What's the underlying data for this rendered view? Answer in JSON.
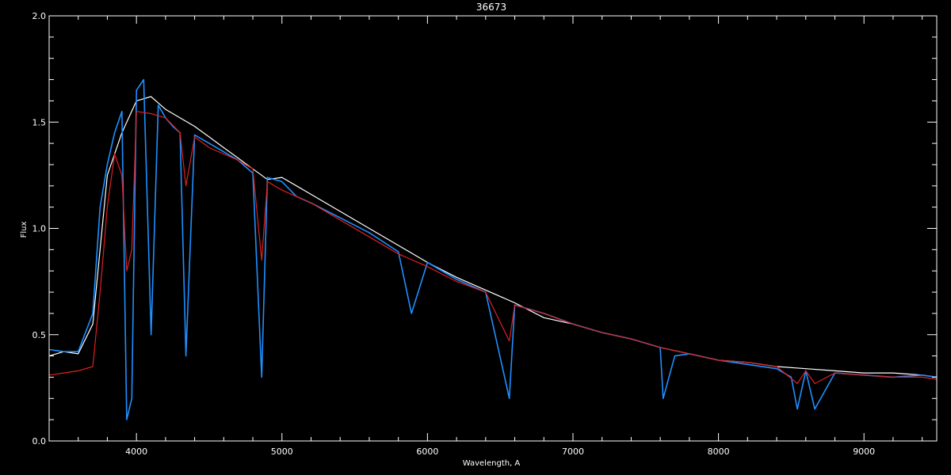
{
  "chart_data": {
    "type": "line",
    "title": "36673",
    "xlabel": "Wavelength, A",
    "ylabel": "Flux",
    "xlim": [
      3400,
      9500
    ],
    "ylim": [
      0.0,
      2.0
    ],
    "x_ticks": [
      4000,
      5000,
      6000,
      7000,
      8000,
      9000
    ],
    "x_tick_labels": [
      "4000",
      "5000",
      "6000",
      "7000",
      "8000",
      "9000"
    ],
    "y_ticks": [
      0.0,
      0.5,
      1.0,
      1.5,
      2.0
    ],
    "y_tick_labels": [
      "0.0",
      "0.5",
      "1.0",
      "1.5",
      "2.0"
    ],
    "background": "#000000",
    "axis_color": "#ffffff",
    "grid": false,
    "series": [
      {
        "color": "#ffffff",
        "x": [
          3400,
          3500,
          3600,
          3700,
          3800,
          3900,
          4000,
          4100,
          4200,
          4300,
          4400,
          4500,
          4600,
          4700,
          4800,
          4900,
          5000,
          5200,
          5400,
          5600,
          5800,
          6000,
          6200,
          6400,
          6600,
          6800,
          7000,
          7200,
          7400,
          7600,
          7800,
          8000,
          8200,
          8400,
          8600,
          8800,
          9000,
          9200,
          9400,
          9500
        ],
        "values": [
          0.4,
          0.42,
          0.41,
          0.55,
          1.25,
          1.45,
          1.6,
          1.62,
          1.56,
          1.52,
          1.48,
          1.43,
          1.38,
          1.33,
          1.28,
          1.23,
          1.24,
          1.16,
          1.08,
          1.0,
          0.92,
          0.84,
          0.77,
          0.71,
          0.65,
          0.58,
          0.55,
          0.51,
          0.48,
          0.44,
          0.41,
          0.38,
          0.37,
          0.35,
          0.34,
          0.33,
          0.32,
          0.32,
          0.31,
          0.3
        ]
      },
      {
        "color": "#1e90ff",
        "x": [
          3400,
          3500,
          3600,
          3700,
          3750,
          3800,
          3850,
          3900,
          3933,
          3968,
          4000,
          4050,
          4101,
          4150,
          4200,
          4250,
          4300,
          4340,
          4400,
          4500,
          4600,
          4700,
          4800,
          4861,
          4900,
          5000,
          5100,
          5200,
          5400,
          5600,
          5800,
          5890,
          6000,
          6200,
          6400,
          6563,
          6600,
          6800,
          7000,
          7200,
          7400,
          7600,
          7620,
          7700,
          7800,
          8000,
          8200,
          8400,
          8500,
          8542,
          8600,
          8662,
          8800,
          9000,
          9200,
          9400,
          9500
        ],
        "values": [
          0.43,
          0.42,
          0.42,
          0.6,
          1.1,
          1.3,
          1.45,
          1.55,
          0.1,
          0.2,
          1.65,
          1.7,
          0.5,
          1.58,
          1.52,
          1.48,
          1.45,
          0.4,
          1.44,
          1.4,
          1.36,
          1.32,
          1.26,
          0.3,
          1.24,
          1.22,
          1.15,
          1.12,
          1.05,
          0.98,
          0.89,
          0.6,
          0.84,
          0.76,
          0.7,
          0.2,
          0.64,
          0.6,
          0.55,
          0.51,
          0.48,
          0.44,
          0.2,
          0.4,
          0.41,
          0.38,
          0.36,
          0.34,
          0.3,
          0.15,
          0.33,
          0.15,
          0.32,
          0.31,
          0.3,
          0.31,
          0.3
        ]
      },
      {
        "color": "#e02020",
        "x": [
          3400,
          3500,
          3600,
          3700,
          3750,
          3800,
          3850,
          3900,
          3933,
          3968,
          4000,
          4100,
          4200,
          4300,
          4340,
          4400,
          4500,
          4600,
          4700,
          4800,
          4861,
          4900,
          5000,
          5200,
          5400,
          5600,
          5800,
          6000,
          6200,
          6400,
          6563,
          6600,
          6800,
          7000,
          7200,
          7400,
          7600,
          7800,
          8000,
          8200,
          8400,
          8542,
          8600,
          8662,
          8800,
          9000,
          9200,
          9400,
          9500
        ],
        "values": [
          0.31,
          0.32,
          0.33,
          0.35,
          0.7,
          1.1,
          1.35,
          1.25,
          0.8,
          0.9,
          1.55,
          1.54,
          1.52,
          1.45,
          1.2,
          1.43,
          1.38,
          1.35,
          1.32,
          1.28,
          0.85,
          1.22,
          1.18,
          1.12,
          1.04,
          0.96,
          0.88,
          0.82,
          0.75,
          0.7,
          0.47,
          0.64,
          0.6,
          0.55,
          0.51,
          0.48,
          0.44,
          0.41,
          0.38,
          0.37,
          0.35,
          0.27,
          0.33,
          0.27,
          0.32,
          0.31,
          0.3,
          0.3,
          0.29
        ]
      }
    ]
  }
}
